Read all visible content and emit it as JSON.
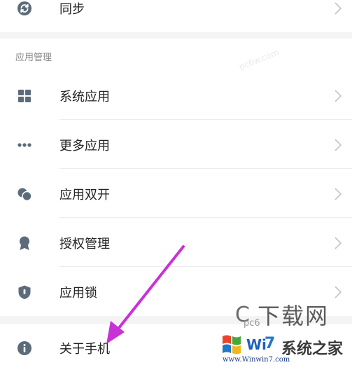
{
  "sync_row": {
    "label": "同步"
  },
  "section": {
    "title": "应用管理"
  },
  "items": [
    {
      "label": "系统应用",
      "icon": "grid-icon"
    },
    {
      "label": "更多应用",
      "icon": "more-dots-icon"
    },
    {
      "label": "应用双开",
      "icon": "dual-app-icon"
    },
    {
      "label": "授权管理",
      "icon": "medal-icon"
    },
    {
      "label": "应用锁",
      "icon": "shield-icon"
    }
  ],
  "about_row": {
    "label": "关于手机",
    "icon": "info-icon"
  },
  "annotation": {
    "color": "#c732d6"
  },
  "watermark": {
    "big": "下载网",
    "small": "pc6",
    "line": "系统之家",
    "url": "www.Winwin7.com",
    "faint": "pc6w.com"
  },
  "colors": {
    "icon": "#5c6b7a",
    "text": "#222222",
    "muted": "#8a8a8a",
    "chevron": "#c4c4c4"
  }
}
